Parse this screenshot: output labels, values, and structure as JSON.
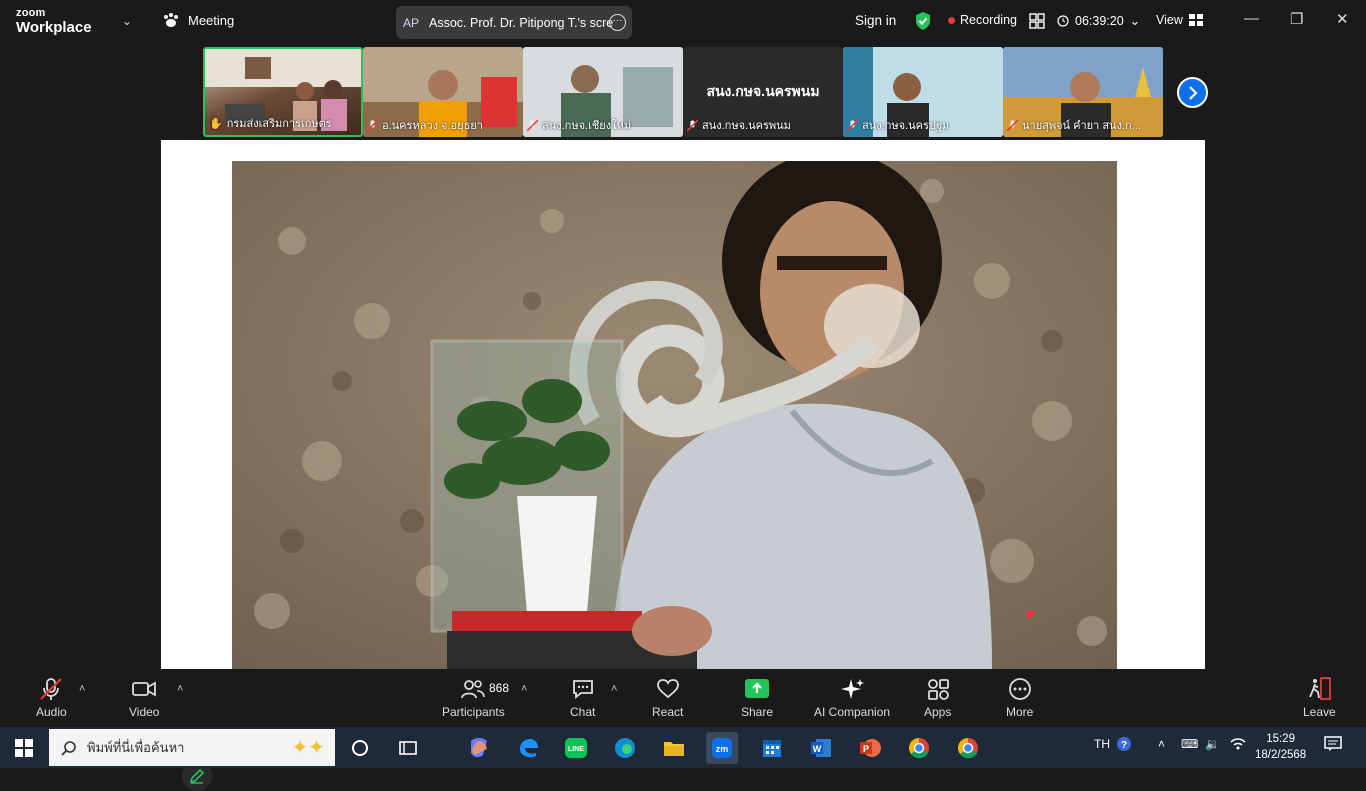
{
  "app": {
    "brand_top": "zoom",
    "brand_bottom": "Workplace"
  },
  "header": {
    "meeting_label": "Meeting",
    "sharer_initials": "AP",
    "sharer_label": "Assoc. Prof. Dr. Pitipong T.'s scre",
    "signin_label": "Sign in",
    "recording_label": "Recording",
    "timer": "06:39:20",
    "view_label": "View"
  },
  "participants": [
    {
      "name": "กรมส่งเสริมการเกษตร",
      "active": true,
      "muted": false
    },
    {
      "name": "อ.นครหลวง จ.อยุธยา",
      "active": false,
      "muted": true
    },
    {
      "name": "สนง.กษจ.เชียงใหม่",
      "active": false,
      "muted": true
    },
    {
      "name": "สนง.กษจ.นครพนม",
      "active": false,
      "muted": true,
      "display_name": "สนง.กษจ.นครพนม"
    },
    {
      "name": "สนง.กษจ.นครปฐม",
      "active": false,
      "muted": true
    },
    {
      "name": "นายสุพจน์ คำยา สนง.ก...",
      "active": false,
      "muted": true
    }
  ],
  "toolbar": {
    "audio": "Audio",
    "video": "Video",
    "participants": "Participants",
    "participants_count": "868",
    "chat": "Chat",
    "react": "React",
    "share": "Share",
    "ai_companion": "AI Companion",
    "apps": "Apps",
    "more": "More",
    "leave": "Leave"
  },
  "taskbar": {
    "search_placeholder": "พิมพ์ที่นี่เพื่อค้นหา",
    "lang": "TH",
    "time": "15:29",
    "date": "18/2/2568"
  },
  "colors": {
    "accent": "#0e71eb",
    "share_green": "#27c25a",
    "record_red": "#e63b3b"
  }
}
